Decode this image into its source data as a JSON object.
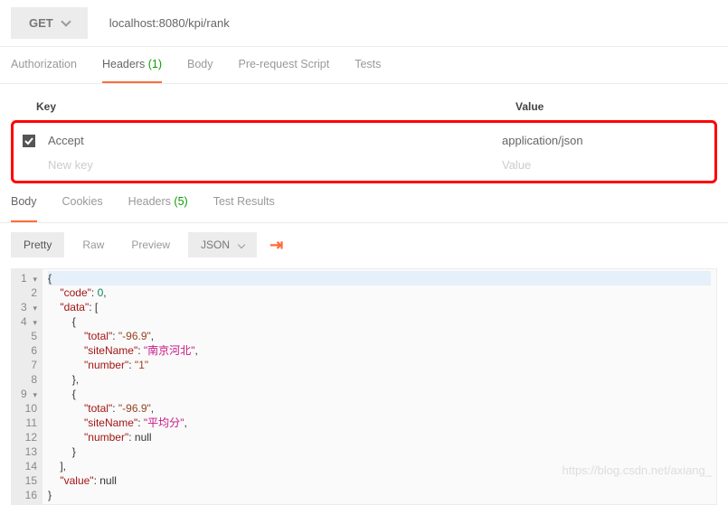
{
  "request": {
    "method": "GET",
    "url": "localhost:8080/kpi/rank"
  },
  "request_tabs": {
    "authorization": "Authorization",
    "headers": "Headers",
    "headers_count": "(1)",
    "body": "Body",
    "prerequest": "Pre-request Script",
    "tests": "Tests"
  },
  "headers_table": {
    "col_key": "Key",
    "col_value": "Value",
    "rows": [
      {
        "key": "Accept",
        "value": "application/json"
      }
    ],
    "new_key": "New key",
    "new_value": "Value"
  },
  "response_tabs": {
    "body": "Body",
    "cookies": "Cookies",
    "headers": "Headers",
    "headers_count": "(5)",
    "testresults": "Test Results"
  },
  "body_toolbar": {
    "pretty": "Pretty",
    "raw": "Raw",
    "preview": "Preview",
    "format": "JSON"
  },
  "response_json": {
    "code": 0,
    "data": [
      {
        "total": "-96.9",
        "siteName": "南京河北",
        "number": "1"
      },
      {
        "total": "-96.9",
        "siteName": "平均分",
        "number": null
      }
    ],
    "value": null
  },
  "watermark": "https://blog.csdn.net/axiang_"
}
